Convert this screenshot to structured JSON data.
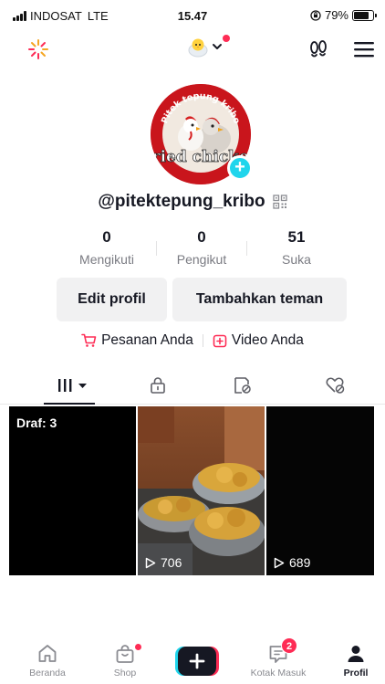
{
  "status_bar": {
    "carrier": "INDOSAT",
    "network": "LTE",
    "time": "15.47",
    "battery": "79%"
  },
  "profile": {
    "username": "@pitektepung_kribo",
    "avatar_text_top": "Pitek tepung kribo",
    "avatar_text_bottom": "Fried chicken",
    "stats": [
      {
        "value": "0",
        "label": "Mengikuti"
      },
      {
        "value": "0",
        "label": "Pengikut"
      },
      {
        "value": "51",
        "label": "Suka"
      }
    ],
    "edit_button": "Edit profil",
    "add_friends_button": "Tambahkan teman",
    "orders_link": "Pesanan Anda",
    "your_videos_link": "Video Anda"
  },
  "tabs": [
    {
      "icon": "grid-icon",
      "active": true
    },
    {
      "icon": "lock-icon",
      "active": false
    },
    {
      "icon": "repost-icon",
      "active": false
    },
    {
      "icon": "liked-icon",
      "active": false
    }
  ],
  "videos": [
    {
      "label": "Draf: 3"
    },
    {
      "views": "706"
    },
    {
      "views": "689"
    }
  ],
  "bottom_nav": {
    "home": "Beranda",
    "shop": "Shop",
    "inbox": "Kotak Masuk",
    "inbox_badge": "2",
    "profile": "Profil"
  },
  "colors": {
    "accent": "#fe2c55",
    "cyan": "#20d5ec",
    "text": "#161823",
    "muted": "#7a7b82",
    "button_bg": "#f1f1f2"
  }
}
